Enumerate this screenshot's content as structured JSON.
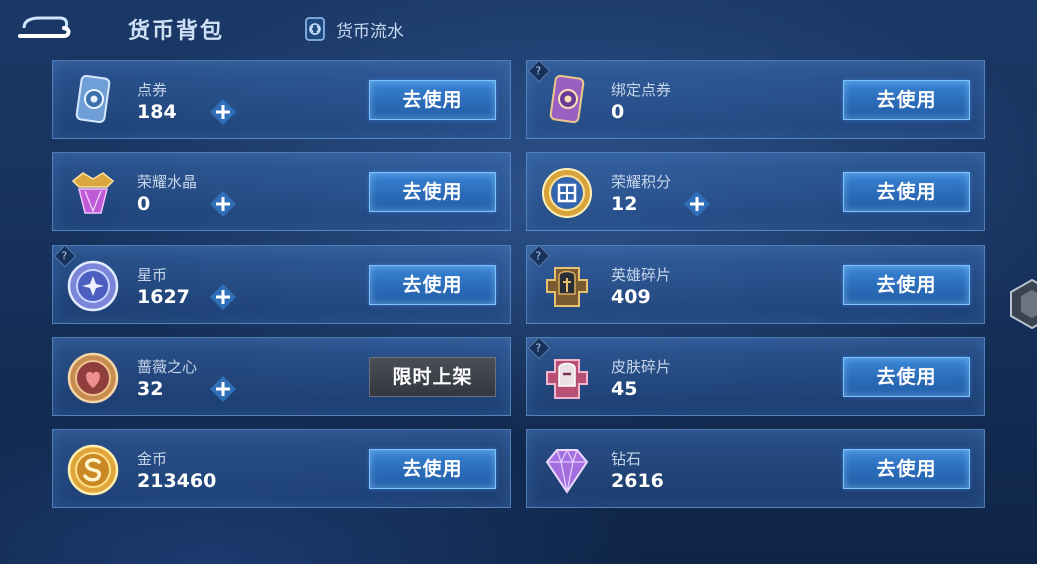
{
  "header": {
    "title": "货币背包",
    "flow_label": "货币流水"
  },
  "items": [
    {
      "name": "点券",
      "amount": "184",
      "action": "去使用",
      "has_plus": true,
      "has_help": false,
      "icon": "coupon-card-blue-icon"
    },
    {
      "name": "绑定点券",
      "amount": "0",
      "action": "去使用",
      "has_plus": false,
      "has_help": true,
      "icon": "coupon-card-purple-icon"
    },
    {
      "name": "荣耀水晶",
      "amount": "0",
      "action": "去使用",
      "has_plus": true,
      "has_help": false,
      "icon": "glory-crystal-icon"
    },
    {
      "name": "荣耀积分",
      "amount": "12",
      "action": "去使用",
      "has_plus": true,
      "has_help": false,
      "icon": "glory-points-icon"
    },
    {
      "name": "星币",
      "amount": "1627",
      "action": "去使用",
      "has_plus": true,
      "has_help": true,
      "icon": "star-coin-icon"
    },
    {
      "name": "英雄碎片",
      "amount": "409",
      "action": "去使用",
      "has_plus": false,
      "has_help": true,
      "icon": "hero-fragment-icon"
    },
    {
      "name": "蔷薇之心",
      "amount": "32",
      "action": "限时上架",
      "has_plus": true,
      "has_help": false,
      "icon": "rose-heart-icon"
    },
    {
      "name": "皮肤碎片",
      "amount": "45",
      "action": "去使用",
      "has_plus": false,
      "has_help": true,
      "icon": "skin-fragment-icon"
    },
    {
      "name": "金币",
      "amount": "213460",
      "action": "去使用",
      "has_plus": false,
      "has_help": false,
      "icon": "gold-coin-icon"
    },
    {
      "name": "钻石",
      "amount": "2616",
      "action": "去使用",
      "has_plus": false,
      "has_help": false,
      "icon": "diamond-icon"
    }
  ],
  "help_symbol": "?",
  "colors": {
    "button_blue": "#2a6bb8",
    "button_disabled": "#3b3f46",
    "card_border": "#78aae6"
  }
}
